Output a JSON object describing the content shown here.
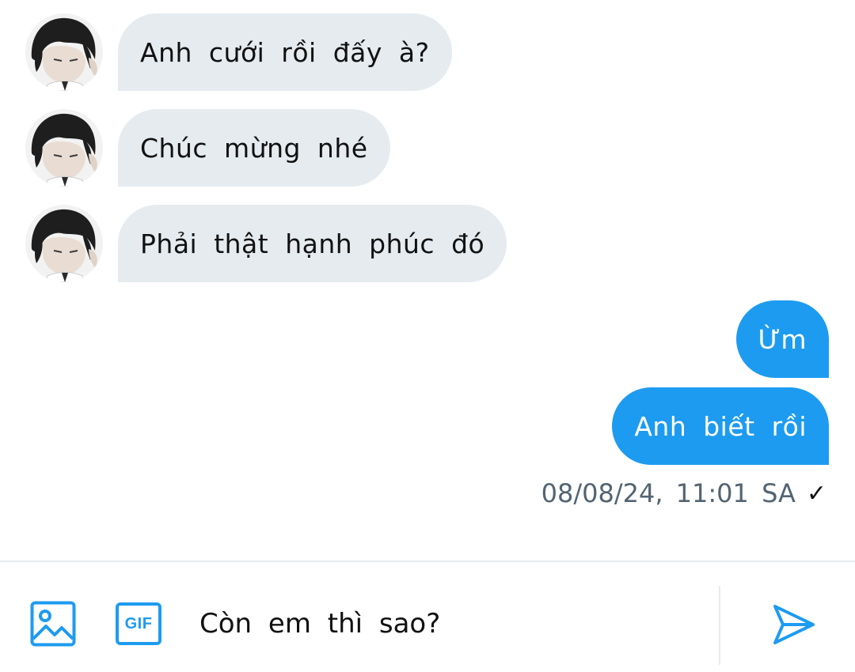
{
  "conversation": {
    "incoming": [
      {
        "text": "Anh cưới rồi đấy à?"
      },
      {
        "text": "Chúc mừng nhé"
      },
      {
        "text": "Phải thật hạnh phúc đó"
      }
    ],
    "outgoing": [
      {
        "text": "Ừm"
      },
      {
        "text": "Anh biết rồi"
      }
    ],
    "timestamp": "08/08/24, 11:01 SA",
    "read_receipt": "✓"
  },
  "composer": {
    "image_icon": "image-icon",
    "gif_label": "GIF",
    "input_value": "Còn em thì sao?",
    "send_icon": "send-icon"
  },
  "colors": {
    "accent": "#1d9bf0",
    "incoming_bubble": "#e6ebef",
    "timestamp_text": "#536471"
  }
}
